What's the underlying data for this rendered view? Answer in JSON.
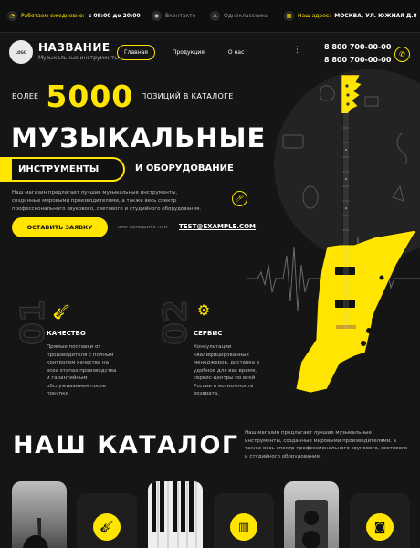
{
  "topbar": {
    "hours_label": "Работаем ежедневно:",
    "hours_value": "с 08:00 до 20:00",
    "vk_label": "Вконтакте",
    "ok_label": "Одноклассники",
    "address_label": "Наш адрес:",
    "address_value": "МОСКВА, УЛ. ЮЖНАЯ Д.8"
  },
  "header": {
    "logo_text": "LOGO",
    "brand": "НАЗВАНИЕ",
    "brand_sub": "Музыкальные инструменты",
    "nav": [
      "Главная",
      "Продукция",
      "О нас"
    ],
    "phone1": "8 800 700-00-00",
    "phone2": "8 800 700-00-00"
  },
  "hero": {
    "more": "БОЛЕЕ",
    "count": "5000",
    "positions": "ПОЗИЦИЙ В КАТАЛОГЕ",
    "title": "МУЗЫКАЛЬНЫЕ",
    "pill": "ИНСТРУМЕНТЫ",
    "sub": "И ОБОРУДОВАНИЕ",
    "description": "Наш магазин предлагает лучшие музыкальные инструменты, созданные мировыми производителями, а также весь спектр профессионального звукового, светового и студийного оборудования.",
    "cta": "ОСТАВИТЬ ЗАЯВКУ",
    "or_text": "или напишите нам",
    "email": "TEST@EXAMPLE.COM"
  },
  "features": [
    {
      "num": "01",
      "icon": "guitar-amp-icon",
      "title": "КАЧЕСТВО",
      "text": "Прямые поставки от производителя с полным контролем качества на всех этапах производства и гарантийным обслуживанием после покупки"
    },
    {
      "num": "02",
      "icon": "gear-service-icon",
      "title": "СЕРВИС",
      "text": "Консультации квалифицированных менеджеров, доставка в удобное для вас время, сервис-центры по всей России и возможность возврата."
    }
  ],
  "catalog": {
    "title": "НАШ КАТАЛОГ",
    "description": "Наш магазин предлагает лучшие музыкальные инструменты, созданные мировыми производителями, а также весь спектр профессионального звукового, светового и студийного оборудования."
  },
  "colors": {
    "accent": "#ffe500",
    "background": "#151515"
  }
}
